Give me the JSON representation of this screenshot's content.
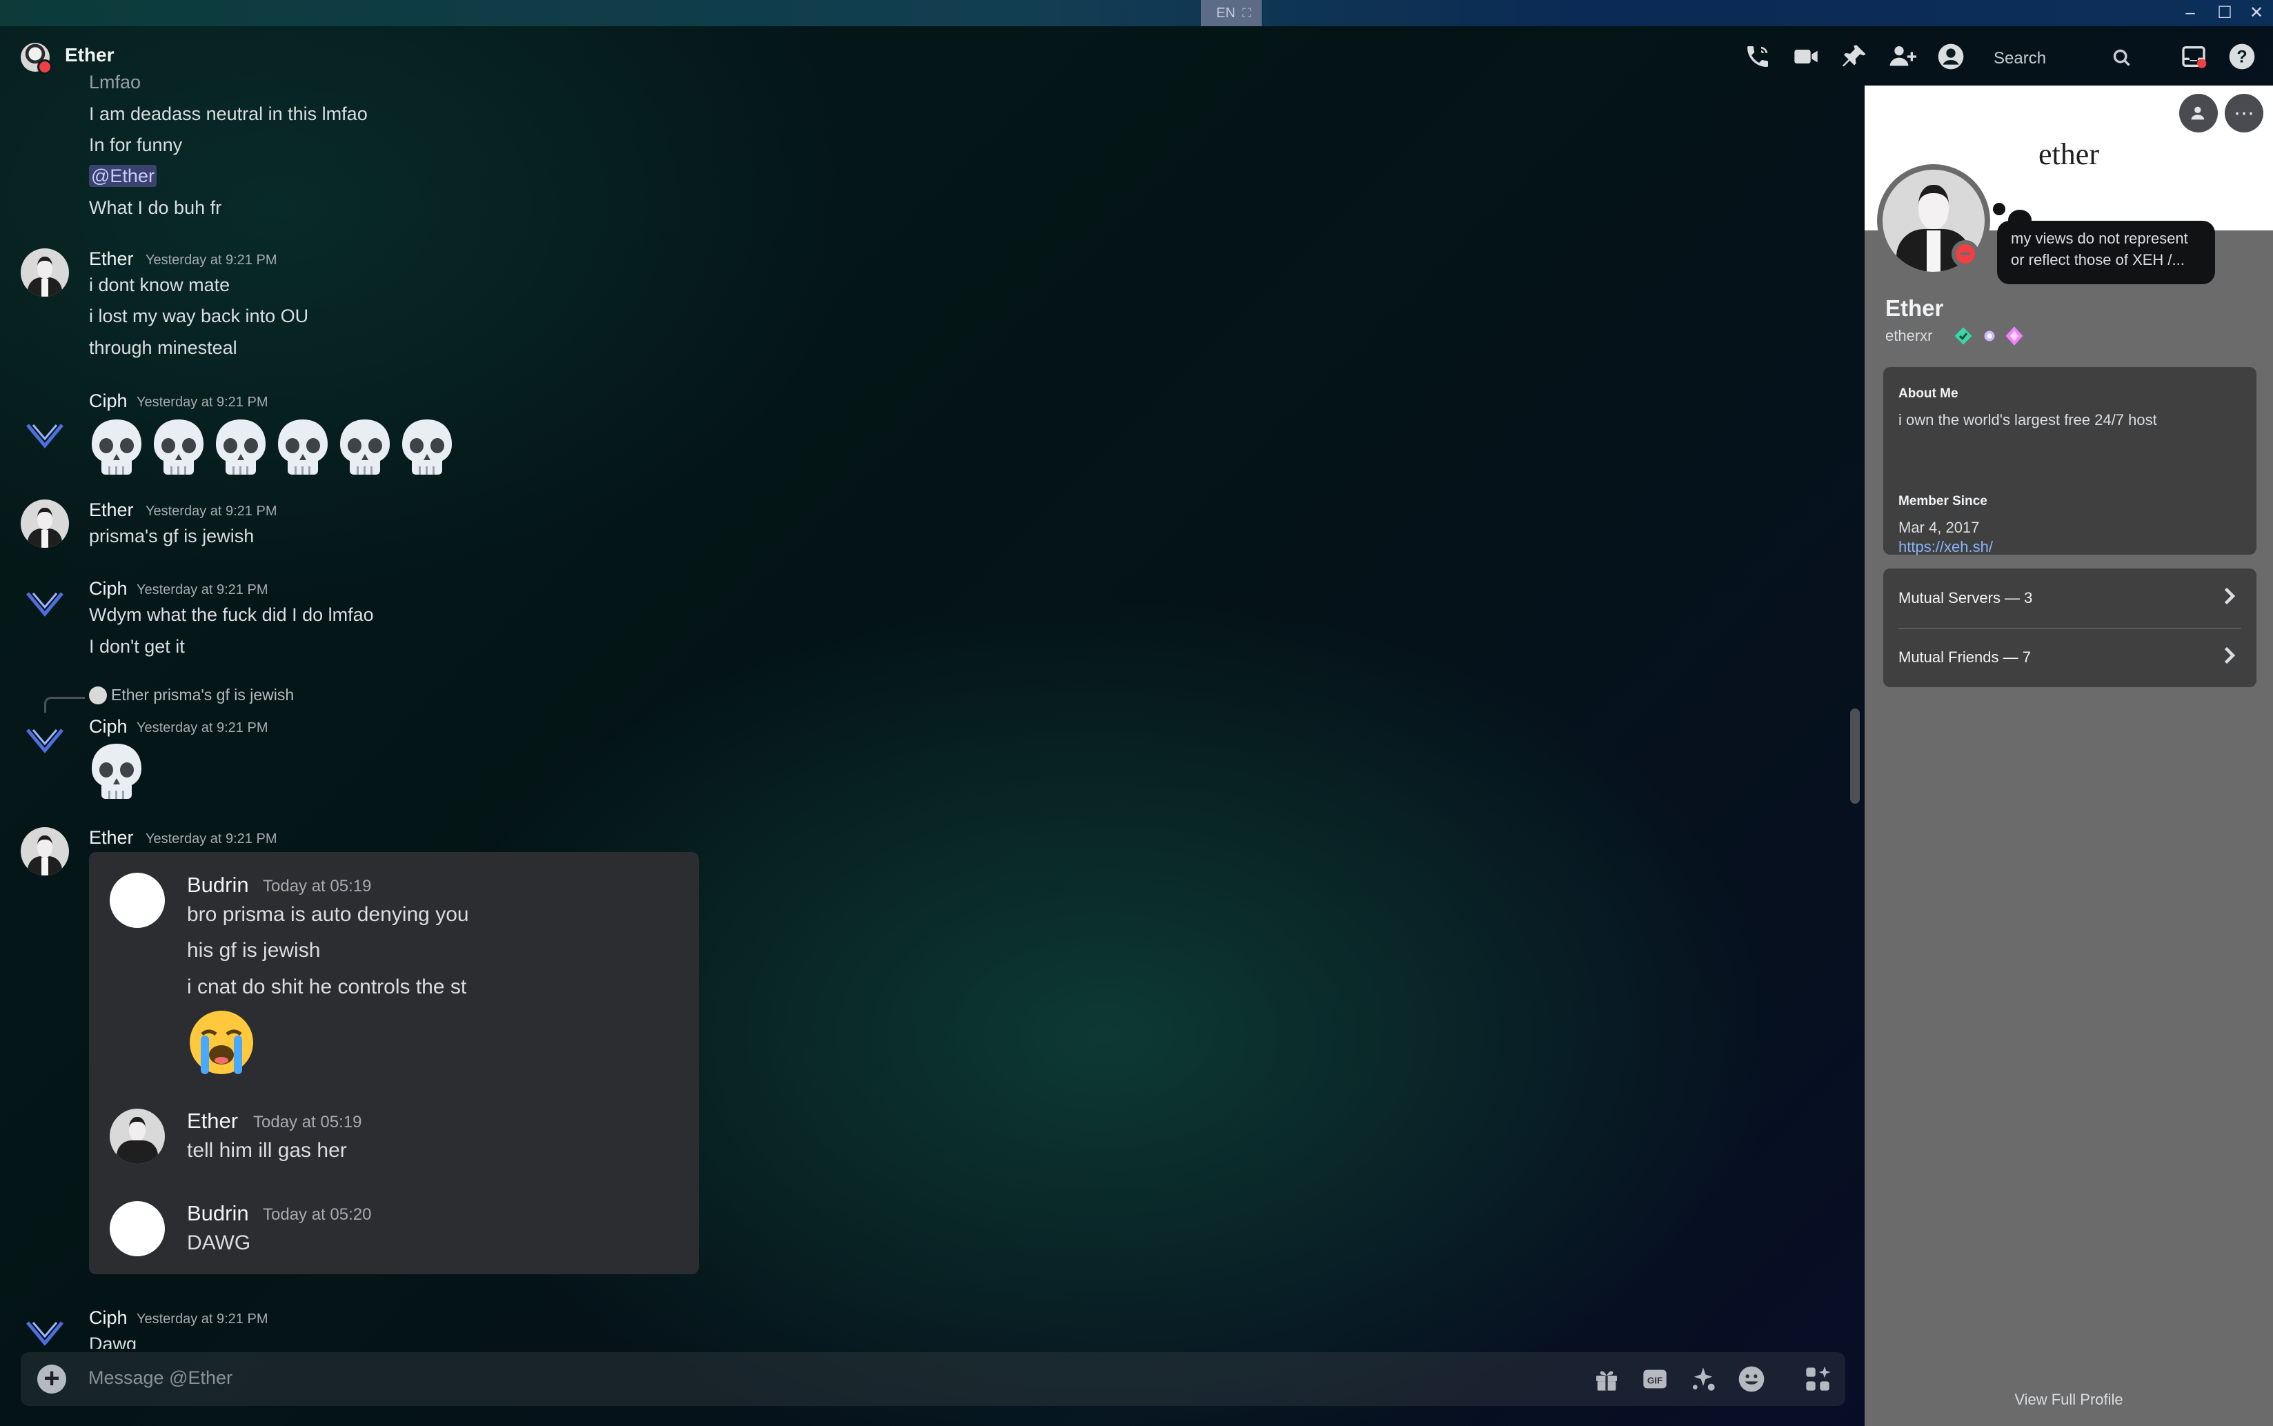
{
  "system": {
    "lang": "EN"
  },
  "header": {
    "name": "Ether",
    "icons": [
      "voice-call-icon",
      "video-call-icon",
      "pin-icon",
      "add-friends-icon",
      "user-profile-icon"
    ],
    "search_placeholder": "Search"
  },
  "messages": [
    {
      "author": "",
      "lines": [
        "Lmfao",
        "I am deadass neutral in this lmfao",
        "In for funny",
        "@Ether",
        "What I do buh fr"
      ]
    },
    {
      "author": "Ether",
      "time": "Yesterday at 9:21 PM",
      "lines": [
        "i dont know mate",
        "i lost my way back into OU",
        "through minesteal"
      ]
    },
    {
      "author": "Ciph",
      "time": "Yesterday at 9:21 PM",
      "emoji": [
        "skull",
        "skull",
        "skull",
        "skull",
        "skull",
        "skull"
      ]
    },
    {
      "author": "Ether",
      "time": "Yesterday at 9:21 PM",
      "lines": [
        "prisma's gf is jewish"
      ]
    },
    {
      "author": "Ciph",
      "time": "Yesterday at 9:21 PM",
      "lines": [
        "Wdym what the fuck did I do lmfao",
        "I don't get it"
      ]
    },
    {
      "reply": {
        "author": "Ether",
        "text": "prisma's gf is jewish"
      },
      "author": "Ciph",
      "time": "Yesterday at 9:21 PM",
      "emoji": [
        "skull"
      ]
    },
    {
      "author": "Ether",
      "time": "Yesterday at 9:21 PM",
      "embed": [
        {
          "author": "Budrin",
          "time": "Today at 05:19",
          "lines": [
            "bro prisma is auto denying you",
            "his gf is jewish",
            "i cnat do shit he controls the st"
          ],
          "emoji": "loudly-crying-face"
        },
        {
          "author": "Ether",
          "time": "Today at 05:19",
          "lines": [
            "tell him ill gas her"
          ]
        },
        {
          "author": "Budrin",
          "time": "Today at 05:20",
          "lines": [
            "DAWG"
          ]
        }
      ]
    },
    {
      "author": "Ciph",
      "time": "Yesterday at 9:21 PM",
      "lines": [
        "Dawg"
      ]
    }
  ],
  "composer": {
    "placeholder": "Message @Ether",
    "icons": [
      "gift-icon",
      "gif-icon",
      "sticker-icon",
      "emoji-icon",
      "apps-icon"
    ]
  },
  "profile": {
    "banner_text": "ether",
    "status": [
      "my views do not represent",
      "or reflect those of XEH /..."
    ],
    "display_name": "Ether",
    "username": "etherxr",
    "about_heading": "About Me",
    "about_text": "i own the world's largest free 24/7 host",
    "link": "https://xeh.sh/",
    "member_since_heading": "Member Since",
    "member_since": "Mar 4, 2017",
    "mutual_servers": "Mutual Servers — 3",
    "mutual_friends": "Mutual Friends — 7",
    "view_full": "View Full Profile"
  },
  "colors": {
    "mention_bg": "#3c4270",
    "dnd": "#f23f43",
    "link": "#8ab4f8",
    "panel_bg": "#6b6b6b",
    "card_bg": "#404040"
  }
}
